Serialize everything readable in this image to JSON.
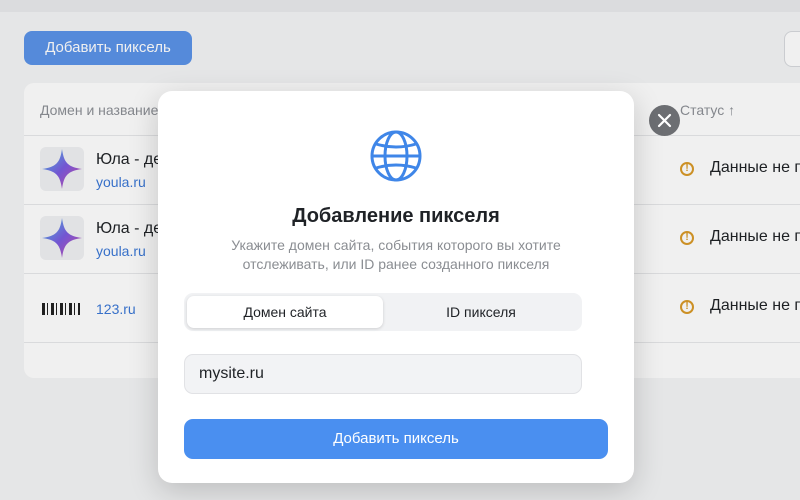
{
  "background": {
    "add_button_label": "Добавить пиксель",
    "table": {
      "col_domain": "Домен и название",
      "col_status": "Статус ↑",
      "rows": [
        {
          "name": "Юла - де",
          "domain": "youla.ru",
          "status": "Данные не п"
        },
        {
          "name": "Юла - де",
          "domain": "youla.ru",
          "status": "Данные не п"
        },
        {
          "name": "",
          "domain": "123.ru",
          "status": "Данные не п"
        }
      ]
    }
  },
  "modal": {
    "icon": "globe-icon",
    "title": "Добавление пикселя",
    "subtitle": "Укажите домен сайта, события которого вы хотите отслеживать, или ID ранее созданного пикселя",
    "tabs": [
      {
        "label": "Домен сайта",
        "active": true
      },
      {
        "label": "ID пикселя",
        "active": false
      }
    ],
    "input_value": "mysite.ru",
    "submit_label": "Добавить пиксель",
    "close_icon": "close-icon"
  },
  "colors": {
    "accent": "#4a8ff0",
    "link": "#3b78d6",
    "warning": "#d99a28"
  }
}
